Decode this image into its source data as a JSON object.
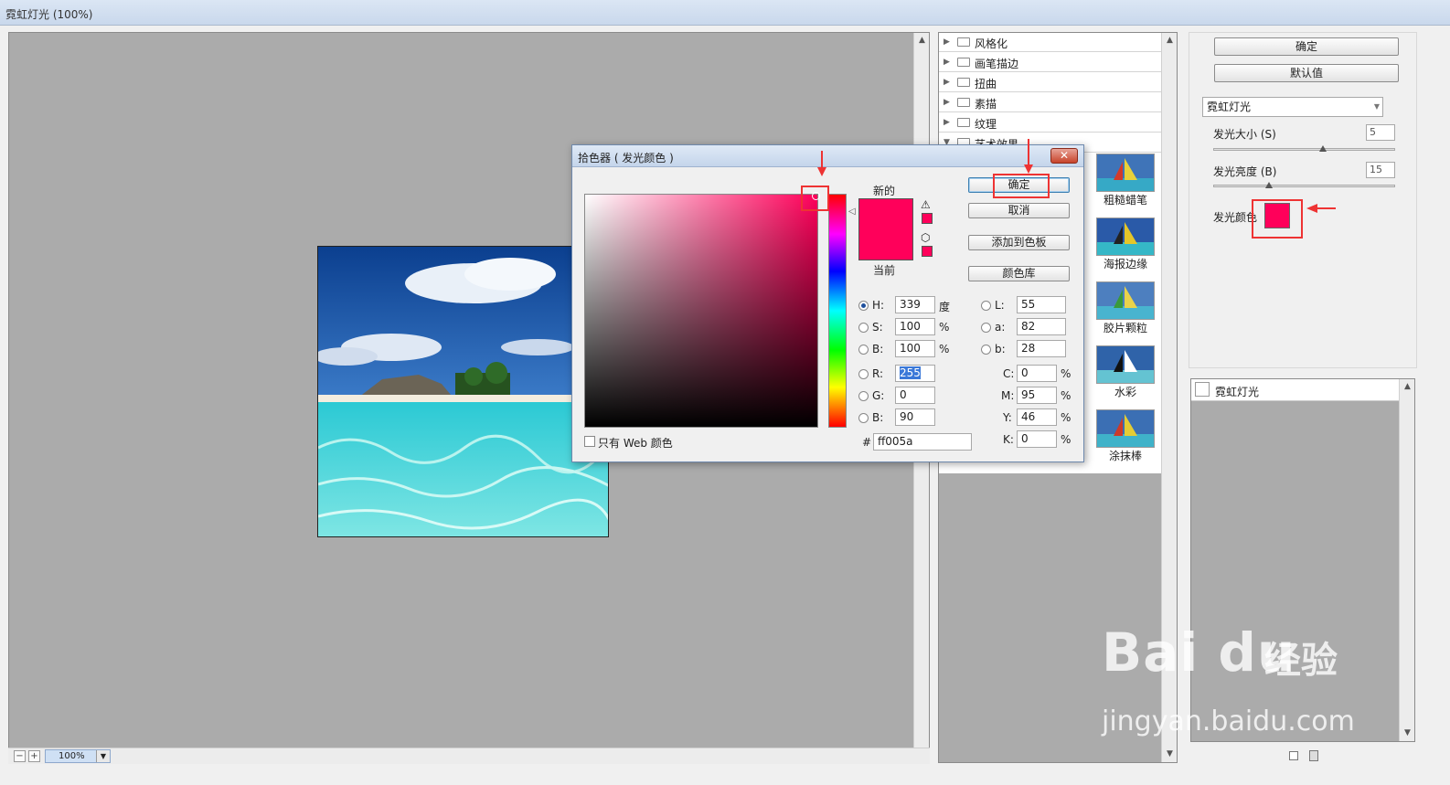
{
  "window": {
    "title": "霓虹灯光 (100%)"
  },
  "preview": {
    "zoom": "100%"
  },
  "filters": {
    "categories": [
      "风格化",
      "画笔描边",
      "扭曲",
      "素描",
      "纹理",
      "艺术效果"
    ],
    "thumbs": [
      "粗糙蜡笔",
      "海报边缘",
      "胶片颗粒",
      "水彩",
      "涂抹棒"
    ]
  },
  "settings": {
    "ok_label": "确定",
    "default_label": "默认值",
    "filter_select": "霓虹灯光",
    "glow_size_label": "发光大小 (S)",
    "glow_size_value": "5",
    "glow_size_level": 0.6,
    "glow_brightness_label": "发光亮度 (B)",
    "glow_brightness_value": "15",
    "glow_brightness_level": 0.3,
    "glow_color_label": "发光颜色",
    "glow_color": "#ff005a"
  },
  "layers": {
    "item": "霓虹灯光"
  },
  "picker": {
    "title": "拾色器 ( 发光颜色 )",
    "new_label": "新的",
    "current_label": "当前",
    "ok": "确定",
    "cancel": "取消",
    "add_swatch": "添加到色板",
    "libraries": "颜色库",
    "web_only": "只有 Web 颜色",
    "H": "339",
    "S": "100",
    "B": "100",
    "R": "255",
    "G": "0",
    "Bv": "90",
    "L": "55",
    "a": "82",
    "b": "28",
    "C": "0",
    "M": "95",
    "Y": "46",
    "K": "0",
    "hex": "ff005a",
    "unit_deg": "度",
    "unit_pct": "%",
    "hex_label": "#",
    "lbl_H": "H:",
    "lbl_S": "S:",
    "lbl_B": "B:",
    "lbl_R": "R:",
    "lbl_G": "G:",
    "lbl_Bv": "B:",
    "lbl_L": "L:",
    "lbl_a": "a:",
    "lbl_b": "b:",
    "lbl_C": "C:",
    "lbl_M": "M:",
    "lbl_Y": "Y:",
    "lbl_K": "K:"
  },
  "watermark": {
    "brand": "Bai du",
    "cn": "经验",
    "url": "jingyan.baidu.com"
  }
}
